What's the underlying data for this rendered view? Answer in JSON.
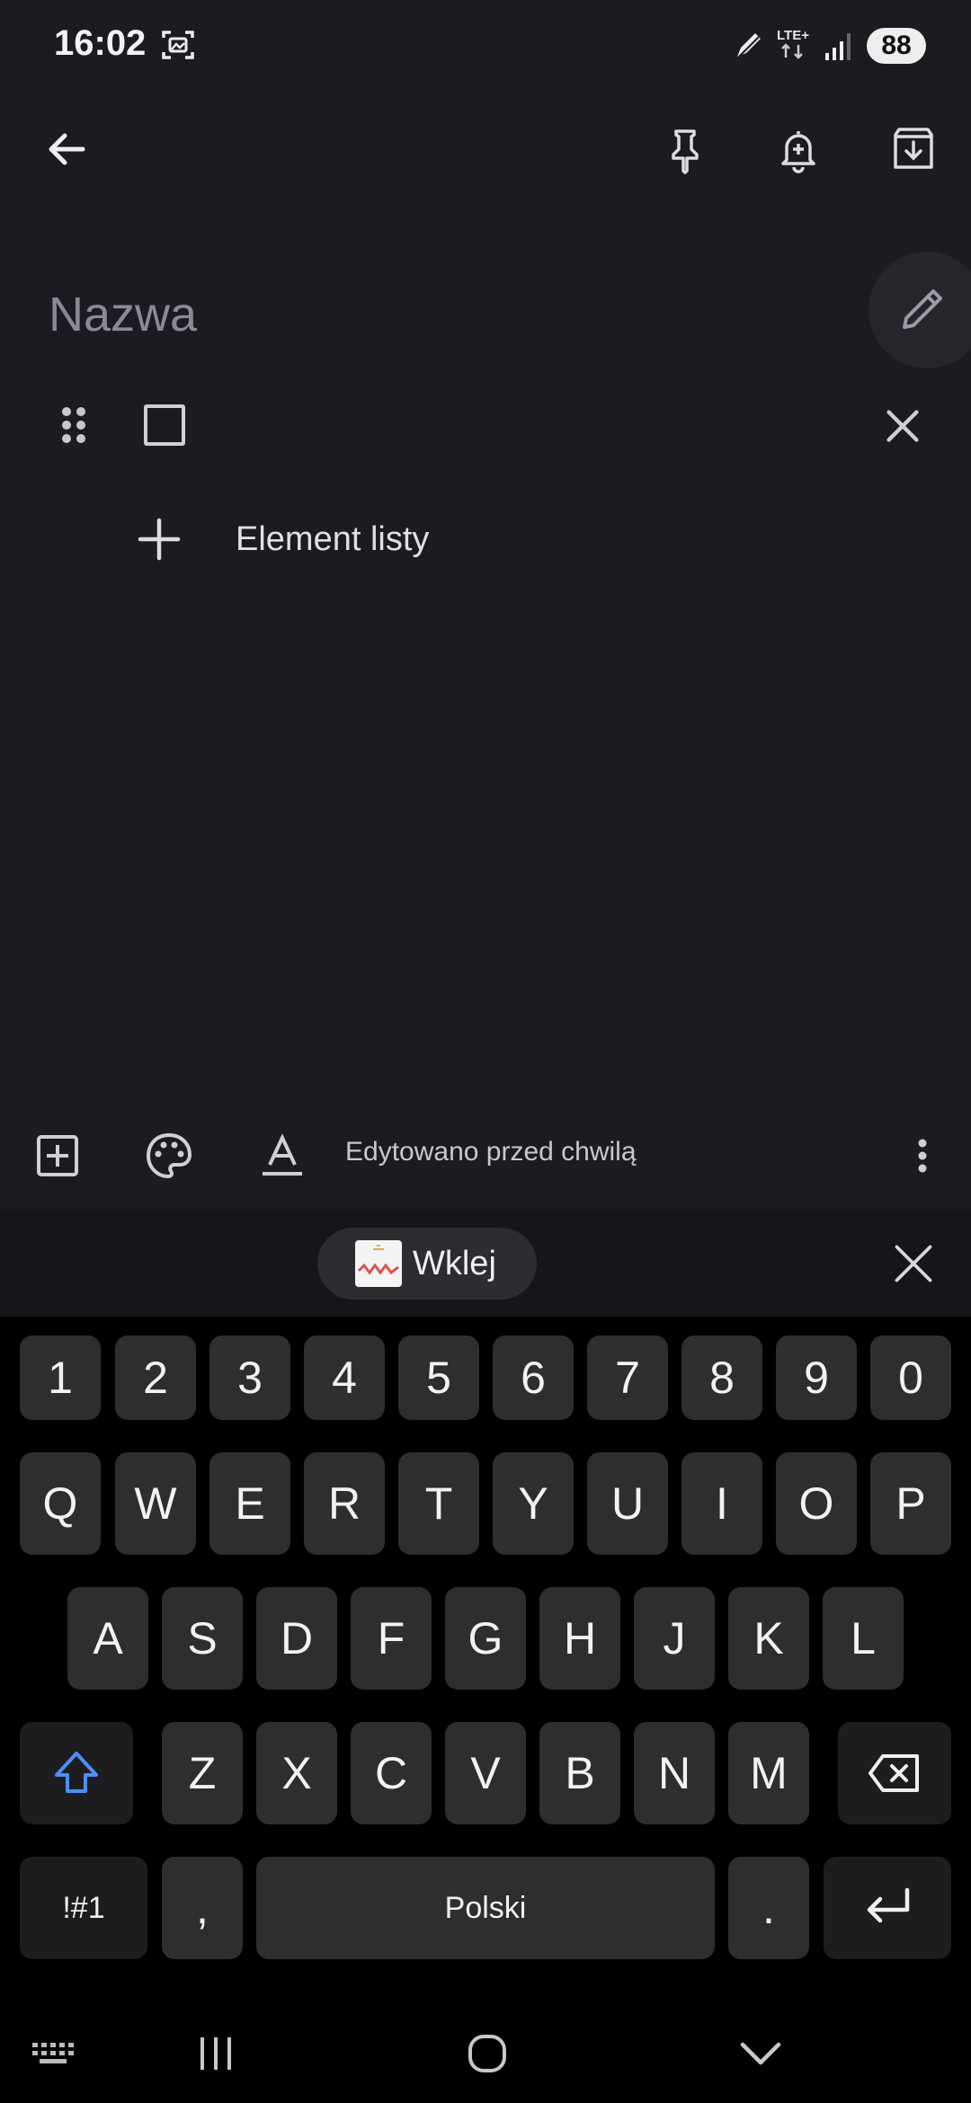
{
  "status_bar": {
    "time": "16:02",
    "network": "LTE+",
    "battery": "88",
    "icons": [
      "screenshot-icon",
      "pen-icon",
      "data-arrows-icon",
      "signal-icon",
      "battery-icon"
    ]
  },
  "toolbar": {
    "icons": [
      "back-arrow-icon",
      "pin-icon",
      "add-reminder-icon",
      "archive-icon"
    ]
  },
  "note": {
    "title_placeholder": "Nazwa",
    "title_value": "",
    "list_item_placeholder": "",
    "add_item_label": "Element listy"
  },
  "bottom_toolbar": {
    "edited_text": "Edytowano przed chwilą",
    "icons": [
      "add-box-icon",
      "palette-icon",
      "text-format-icon",
      "more-vert-icon"
    ]
  },
  "clipboard": {
    "paste_label": "Wklej"
  },
  "keyboard": {
    "row_numbers": [
      "1",
      "2",
      "3",
      "4",
      "5",
      "6",
      "7",
      "8",
      "9",
      "0"
    ],
    "row_qwerty": [
      "Q",
      "W",
      "E",
      "R",
      "T",
      "Y",
      "U",
      "I",
      "O",
      "P"
    ],
    "row_asdf": [
      "A",
      "S",
      "D",
      "F",
      "G",
      "H",
      "J",
      "K",
      "L"
    ],
    "row_zxcv": [
      "Z",
      "X",
      "C",
      "V",
      "B",
      "N",
      "M"
    ],
    "symbols_label": "!#1",
    "comma": ",",
    "space_label": "Polski",
    "period": "."
  },
  "colors": {
    "background": "#1b1b21",
    "keyboard_bg": "#000000",
    "key_bg": "#2e2e30",
    "shift_accent": "#4d8ef5"
  }
}
